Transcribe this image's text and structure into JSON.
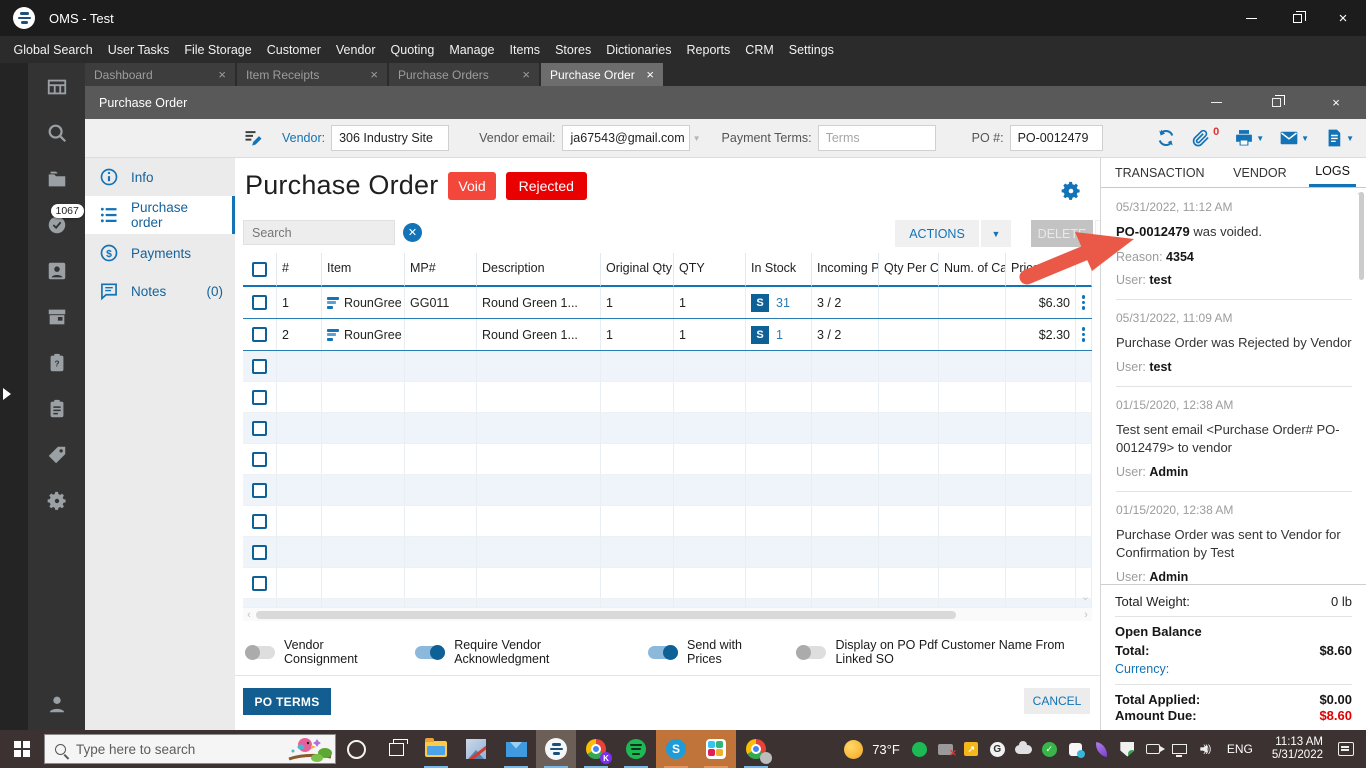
{
  "colors": {
    "accent": "#1273b6",
    "accent_dark": "#0e6197",
    "void_badge": "#f4473c",
    "rejected_badge": "#e90000",
    "amount_due_red": "#e00000",
    "annotation_arrow": "#ea5948"
  },
  "titlebar": {
    "title": "OMS - Test"
  },
  "menu": {
    "items": [
      "Global Search",
      "User Tasks",
      "File Storage",
      "Customer",
      "Vendor",
      "Quoting",
      "Manage",
      "Items",
      "Stores",
      "Dictionaries",
      "Reports",
      "CRM",
      "Settings"
    ]
  },
  "tabs": {
    "items": [
      {
        "label": "Dashboard"
      },
      {
        "label": "Item Receipts"
      },
      {
        "label": "Purchase Orders"
      },
      {
        "label": "Purchase Order"
      }
    ],
    "active_index": 3
  },
  "sidebar": {
    "badge_count": "1067",
    "icons": [
      "dashboard",
      "search",
      "file-storage",
      "tasks-check",
      "contacts",
      "store",
      "help-clipboard",
      "order-clipboard",
      "tags",
      "settings",
      "user"
    ]
  },
  "inner_window": {
    "title": "Purchase Order"
  },
  "po_header": {
    "edit_icon": "edit-vendor",
    "vendor_label": "Vendor:",
    "vendor_value": "306 Industry Site",
    "email_label": "Vendor email:",
    "email_value": "ja67543@gmail.com",
    "terms_label": "Payment Terms:",
    "terms_placeholder": "Terms",
    "po_label": "PO #:",
    "po_value": "PO-0012479",
    "attachments_count": "0",
    "icons": [
      "refresh",
      "attachments",
      "print",
      "email",
      "export-document"
    ]
  },
  "nav": {
    "active_index": 1,
    "items": [
      {
        "label": "Info"
      },
      {
        "label": "Purchase order"
      },
      {
        "label": "Payments"
      },
      {
        "label": "Notes",
        "count": "(0)"
      }
    ]
  },
  "content": {
    "title": "Purchase Order",
    "badges": [
      {
        "label": "Void",
        "color": "#f4473c"
      },
      {
        "label": "Rejected",
        "color": "#e90000"
      }
    ],
    "search_placeholder": "Search",
    "actions_label": "ACTIONS",
    "delete_label": "DELETE",
    "table": {
      "columns": [
        "#",
        "Item",
        "MP#",
        "Description",
        "Original Qty",
        "QTY",
        "In Stock",
        "Incoming PO",
        "Qty Per Carton",
        "Num. of Cartons",
        "Price"
      ],
      "rows": [
        {
          "num": "1",
          "item": "RounGree",
          "mp": "GG011",
          "desc": "Round Green 1...",
          "orig_qty": "1",
          "qty": "1",
          "stock_tag": "S",
          "in_stock": "31",
          "incoming": "3 / 2",
          "qty_carton": "",
          "cartons": "",
          "price": "$6.30"
        },
        {
          "num": "2",
          "item": "RounGree",
          "mp": "",
          "desc": "Round Green 1...",
          "orig_qty": "1",
          "qty": "1",
          "stock_tag": "S",
          "in_stock": "1",
          "incoming": "3 / 2",
          "qty_carton": "",
          "cartons": "",
          "price": "$2.30"
        }
      ],
      "empty_row_count": 9
    },
    "toggles": [
      {
        "label": "Vendor Consignment",
        "on": false
      },
      {
        "label": "Require Vendor Acknowledgment",
        "on": true
      },
      {
        "label": "Send with Prices",
        "on": true
      },
      {
        "label": "Display on PO Pdf Customer Name From Linked SO",
        "on": false
      }
    ],
    "po_terms_label": "PO TERMS",
    "cancel_label": "CANCEL"
  },
  "right_panel": {
    "tabs": [
      "TRANSACTION",
      "VENDOR",
      "LOGS"
    ],
    "active_tab": "LOGS",
    "logs": [
      {
        "date": "05/31/2022, 11:12 AM",
        "message_bold": "PO-0012479",
        "message": " was voided.",
        "reason_label": "Reason:",
        "reason_value": "4354",
        "user_label": "User:",
        "user_value": "test"
      },
      {
        "date": "05/31/2022, 11:09 AM",
        "message": "Purchase Order was Rejected by Vendor",
        "user_label": "User:",
        "user_value": "test"
      },
      {
        "date": "01/15/2020, 12:38 AM",
        "message": "Test sent email <Purchase Order# PO-0012479> to vendor",
        "user_label": "User:",
        "user_value": "Admin"
      },
      {
        "date": "01/15/2020, 12:38 AM",
        "message": "Purchase Order was sent to Vendor for Confirmation by Test",
        "user_label": "User:",
        "user_value": "Admin"
      }
    ],
    "summary": {
      "total_weight_label": "Total Weight:",
      "total_weight_value": "0 lb",
      "open_balance_label": "Open Balance",
      "total_label": "Total:",
      "total_value": "$8.60",
      "currency_label": "Currency:",
      "total_applied_label": "Total Applied:",
      "total_applied_value": "$0.00",
      "amount_due_label": "Amount Due:",
      "amount_due_value": "$8.60"
    }
  },
  "taskbar": {
    "search_placeholder": "Type here to search",
    "weather": "73°F",
    "language": "ENG",
    "time": "11:13 AM",
    "date": "5/31/2022"
  }
}
